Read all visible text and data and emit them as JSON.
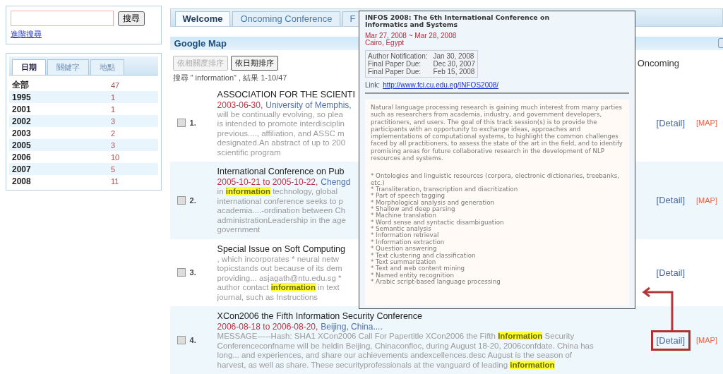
{
  "sidebar": {
    "search": {
      "button": "搜尋",
      "advanced_link": "進階搜尋"
    },
    "facet_tabs": [
      {
        "label": "日期",
        "selected": true
      },
      {
        "label": "關鍵字",
        "selected": false
      },
      {
        "label": "地點",
        "selected": false
      }
    ],
    "facets": [
      {
        "label": "全部",
        "count": "47"
      },
      {
        "label": "1995",
        "count": "1"
      },
      {
        "label": "2001",
        "count": "1"
      },
      {
        "label": "2002",
        "count": "3"
      },
      {
        "label": "2003",
        "count": "2"
      },
      {
        "label": "2005",
        "count": "3"
      },
      {
        "label": "2006",
        "count": "10"
      },
      {
        "label": "2007",
        "count": "5"
      },
      {
        "label": "2008",
        "count": "11"
      }
    ]
  },
  "tabs": [
    {
      "label": "Welcome",
      "selected": true
    },
    {
      "label": "Oncoming Conference",
      "selected": false
    },
    {
      "label": "F",
      "selected": false
    }
  ],
  "panel_title": "Google Map",
  "sort_buttons": [
    {
      "label": "依相關度排序",
      "disabled": true
    },
    {
      "label": "依日期排序",
      "disabled": false
    }
  ],
  "column_3_heading": "Oncoming",
  "result_summary": "搜尋 \" information\" , 結果 1-10/47",
  "results": [
    {
      "number": "1.",
      "checked": false,
      "title": "ASSOCIATION FOR THE SCIENTI",
      "date": "2003-06-30,",
      "place": "University of Memphis,",
      "snippet": [
        "will be continually evolving, so plea",
        "is intended to promote interdisciplin",
        "previous...., affiliation, and ASSC m",
        "designated.An abstract of up to 200",
        "scientific program"
      ],
      "links": [
        {
          "kind": "detail",
          "label": "[Detail]",
          "highlighted": false
        },
        {
          "kind": "map",
          "label": "[MAP]",
          "highlighted": false
        }
      ]
    },
    {
      "number": "2.",
      "checked": false,
      "title": "International Conference on Pub",
      "date": "2005-10-21 to 2005-10-22,",
      "place": "Chengd",
      "snippet": [
        "in **information** technology, global",
        "international conference seeks to p",
        "academia....-ordination between Ch",
        "administrationLeadership in the age",
        "government"
      ],
      "links": [
        {
          "kind": "detail",
          "label": "[Detail]",
          "highlighted": false
        },
        {
          "kind": "map",
          "label": "[MAP]",
          "highlighted": false
        }
      ]
    },
    {
      "number": "3.",
      "checked": false,
      "title": "Special Issue on Soft Computing",
      "snippet": [
        ", which incorporates * neural netw",
        "topicstands out because of its dem",
        "providing... asjagath@ntu.edu.sg *",
        "author contact **information** in text",
        "journal, such as Instructions"
      ],
      "links": [
        {
          "kind": "detail",
          "label": "[Detail]",
          "highlighted": false
        }
      ]
    },
    {
      "number": "4.",
      "checked": false,
      "title": "XCon2006 the Fifth Information Security Conference",
      "date": "2006-08-18 to 2006-08-20,",
      "place": "Beijing, China....",
      "snippet": [
        "MESSAGE-----Hash: SHA1 XCon2006 Call For Papertitle XCon2006 the Fifth **Information** Security",
        "Conferenceconfname will be heldin Beijing, Chinaconfloc, during August 18-20, 2006confdate. China has",
        "long... and experiences, and share our achievements andexcellences.desc August is the season of",
        "harvest, as well as share. These securityprofessionals at the vanguard of leading **information**"
      ],
      "links": [
        {
          "kind": "detail",
          "label": "[Detail]",
          "highlighted": true
        },
        {
          "kind": "map",
          "label": "[MAP]",
          "highlighted": false
        }
      ]
    }
  ],
  "popup": {
    "title": "INFOS 2008: The 6th International Conference on Informatics and Systems",
    "dates": "Mar 27, 2008 ~ Mar 28, 2008",
    "location": "Cairo, Egypt",
    "deadlines": [
      {
        "label": "Author Notification:",
        "date": "Jan 30, 2008"
      },
      {
        "label": "Final Paper Due:",
        "date": "Dec 30, 2007"
      },
      {
        "label": "Final Paper Due:",
        "date": "Feb 15, 2008"
      }
    ],
    "link_label": "Link:",
    "link": "http://www.fci.cu.edu.eg/INFOS2008/",
    "description": "Natural language processing research is gaining much interest from many parties such as researchers from academia, industry, and government developers, practitioners, and users. The goal of this track session(s) is to provide the participants with an opportunity to exchange ideas, approaches and implementations of computational systems, to highlight the common challenges faced by all practitioners, to assess the state of the art in the field, and to identify promising areas for future collaborative research in the development of NLP resources and systems.",
    "topics": [
      "* Ontologies and linguistic resources (corpora, electronic dictionaries, treebanks, etc.)",
      "* Transliteration, transcription and diacritization",
      "* Part of speech tagging",
      "* Morphological analysis and generation",
      "* Shallow and deep parsing",
      "* Machine translation",
      "* Word sense and syntactic disambiguation",
      "* Semantic analysis",
      "* Information retrieval",
      "* Information extraction",
      "* Question answering",
      "* Text clustering and classification",
      "* Text summarization",
      "* Text and web content mining",
      "* Named entity recognition",
      "* Arabic script-based language processing"
    ]
  }
}
